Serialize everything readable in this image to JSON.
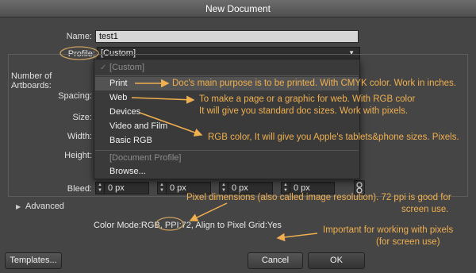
{
  "window": {
    "title": "New Document"
  },
  "form": {
    "name_label": "Name:",
    "name_value": "test1",
    "profile_label": "Profile:",
    "profile_value": "[Custom]",
    "artboards_label": "Number of Artboards:",
    "spacing_label": "Spacing:",
    "size_label": "Size:",
    "width_label": "Width:",
    "height_label": "Height:",
    "bleed_label": "Bleed:",
    "bleed_values": [
      "0 px",
      "0 px",
      "0 px",
      "0 px"
    ],
    "advanced_label": "Advanced",
    "summary": "Color Mode:RGB, PPI:72, Align to Pixel Grid:Yes"
  },
  "profile_menu": {
    "items": [
      {
        "label": "[Custom]",
        "enabled": false,
        "checked": true
      },
      {
        "label": "Print",
        "enabled": true,
        "selected": true
      },
      {
        "label": "Web",
        "enabled": true
      },
      {
        "label": "Devices",
        "enabled": true
      },
      {
        "label": "Video and Film",
        "enabled": true
      },
      {
        "label": "Basic RGB",
        "enabled": true
      },
      {
        "label": "[Document Profile]",
        "enabled": false
      },
      {
        "label": "Browse...",
        "enabled": true
      }
    ]
  },
  "annotations": {
    "print": "Doc's main purpose is to be printed. With CMYK color. Work in inches.",
    "web_line1": "To make a page or a graphic for web. With RGB color",
    "web_line2": "It will give you standard doc sizes. Work with pixels.",
    "devices": "RGB color, It will give you Apple's tablets&phone sizes. Pixels.",
    "pixel_line1": "Pixel dimensions (also called image resolution). 72 ppi is good for",
    "pixel_line2": "screen use.",
    "align_line1": "Important for working with pixels",
    "align_line2": "(for screen use)"
  },
  "buttons": {
    "templates": "Templates...",
    "cancel": "Cancel",
    "ok": "OK"
  },
  "colors": {
    "annotation": "#f0b050",
    "dialog_bg": "#454545"
  },
  "icons": {
    "menu_check": "check-icon",
    "dropdown": "chevron-down-icon",
    "link": "chain-link-icon",
    "disclosure": "triangle-right-icon"
  }
}
